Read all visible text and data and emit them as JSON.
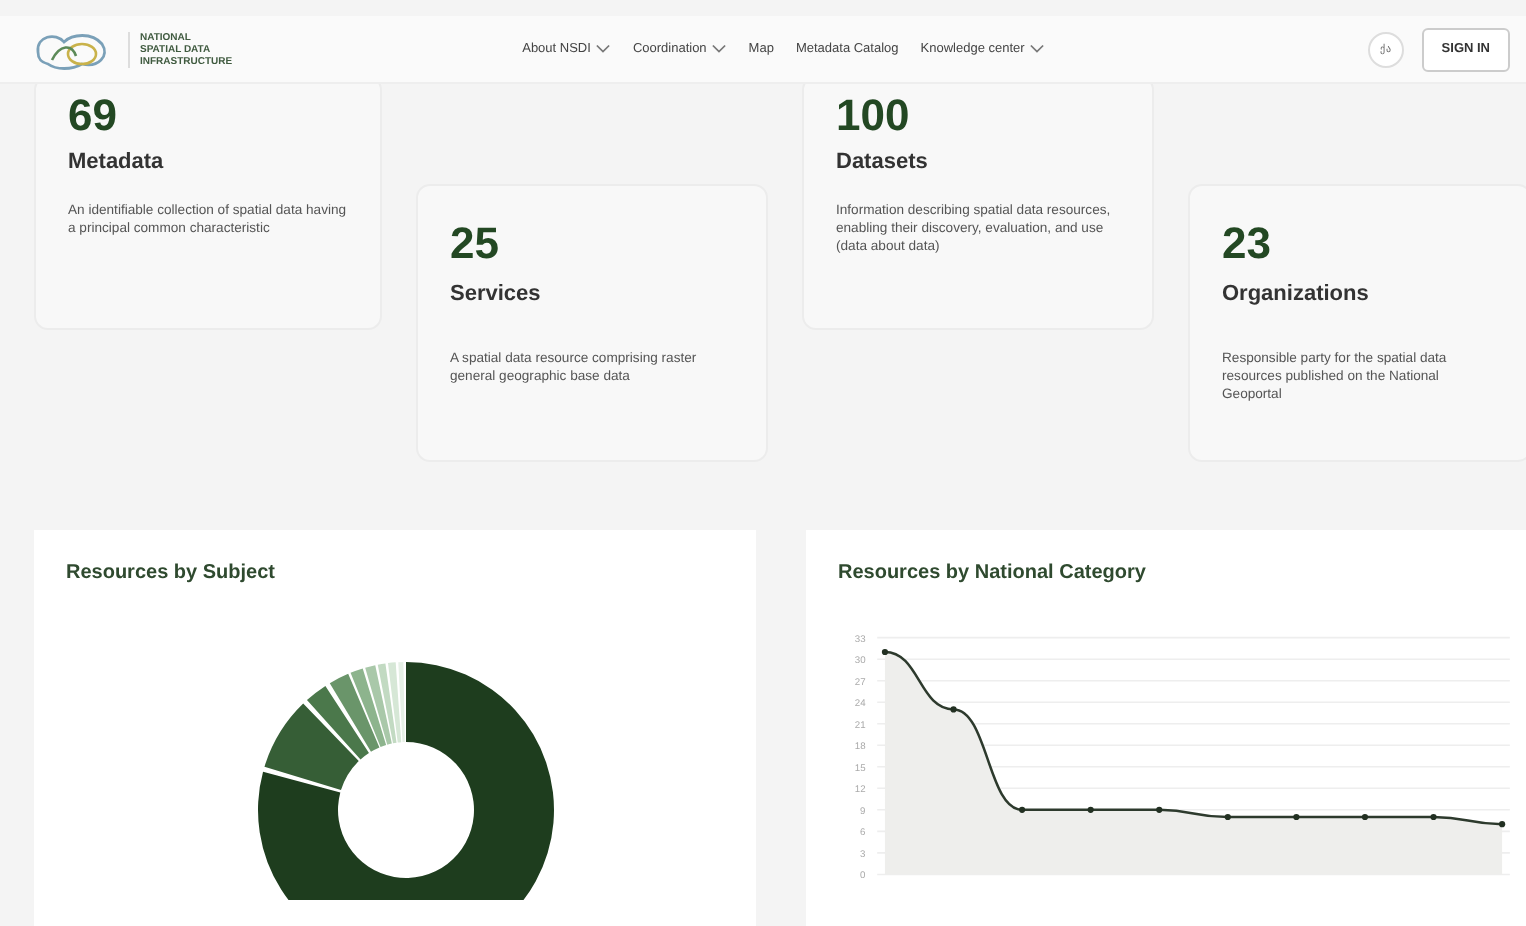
{
  "header": {
    "logo_lines": [
      "NATIONAL",
      "SPATIAL DATA",
      "INFRASTRUCTURE"
    ],
    "nav": [
      {
        "label": "About NSDI",
        "dropdown": true
      },
      {
        "label": "Coordination",
        "dropdown": true
      },
      {
        "label": "Map",
        "dropdown": false
      },
      {
        "label": "Metadata Catalog",
        "dropdown": false
      },
      {
        "label": "Knowledge center",
        "dropdown": true
      }
    ],
    "language": "ქა",
    "sign_in": "SIGN IN"
  },
  "stats": [
    {
      "value": "69",
      "title": "Metadata",
      "description": "An identifiable collection of spatial data having a principal common characteristic"
    },
    {
      "value": "25",
      "title": "Services",
      "description": "A spatial data resource comprising raster general geographic base data"
    },
    {
      "value": "100",
      "title": "Datasets",
      "description": "Information describing spatial data resources, enabling their discovery, evaluation, and use (data about data)"
    },
    {
      "value": "23",
      "title": "Organizations",
      "description": "Responsible party for the spatial data resources published on the National Geoportal"
    }
  ],
  "panels": [
    {
      "title": "Resources by Subject",
      "kind": "donut"
    },
    {
      "title": "Resources by National Category",
      "kind": "line",
      "chart_data": {
        "type": "area",
        "values": [
          31,
          23,
          9,
          9,
          9,
          8,
          8,
          8,
          8,
          7
        ],
        "ylim": [
          0,
          33
        ],
        "grid": true,
        "yticks": [
          0,
          3,
          6,
          9,
          12,
          15,
          18,
          21,
          24,
          27,
          30,
          33
        ]
      }
    }
  ]
}
